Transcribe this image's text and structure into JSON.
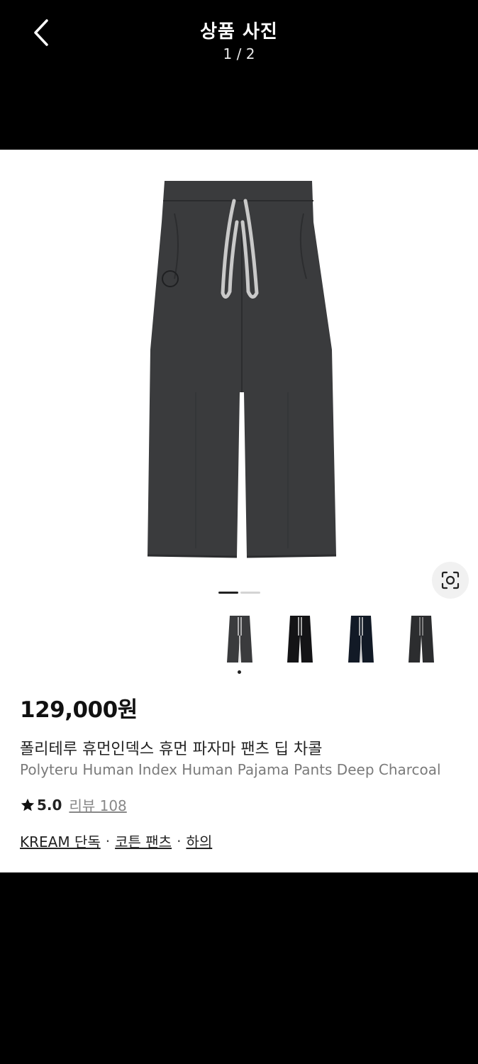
{
  "header": {
    "title": "상품 사진",
    "counter": "1 / 2"
  },
  "gallery": {
    "active_index": 1,
    "total": 2,
    "thumbnails": [
      "thumb-1",
      "thumb-2",
      "thumb-3",
      "thumb-4"
    ],
    "selected_thumbnail": 1
  },
  "product": {
    "price": "129,000원",
    "name_ko": "폴리테루 휴먼인덱스 휴먼 파자마 팬츠 딥 차콜",
    "name_en": "Polyteru Human Index Human Pajama Pants Deep Charcoal",
    "rating": "5.0",
    "review_label": "리뷰 108"
  },
  "tags": {
    "items": [
      "KREAM 단독",
      "코튼 팬츠",
      "하의"
    ],
    "separator": "·"
  },
  "colors": {
    "header_bg": "#000000",
    "pants": "#3a3b3d",
    "drawstring": "#c9c9c9"
  }
}
